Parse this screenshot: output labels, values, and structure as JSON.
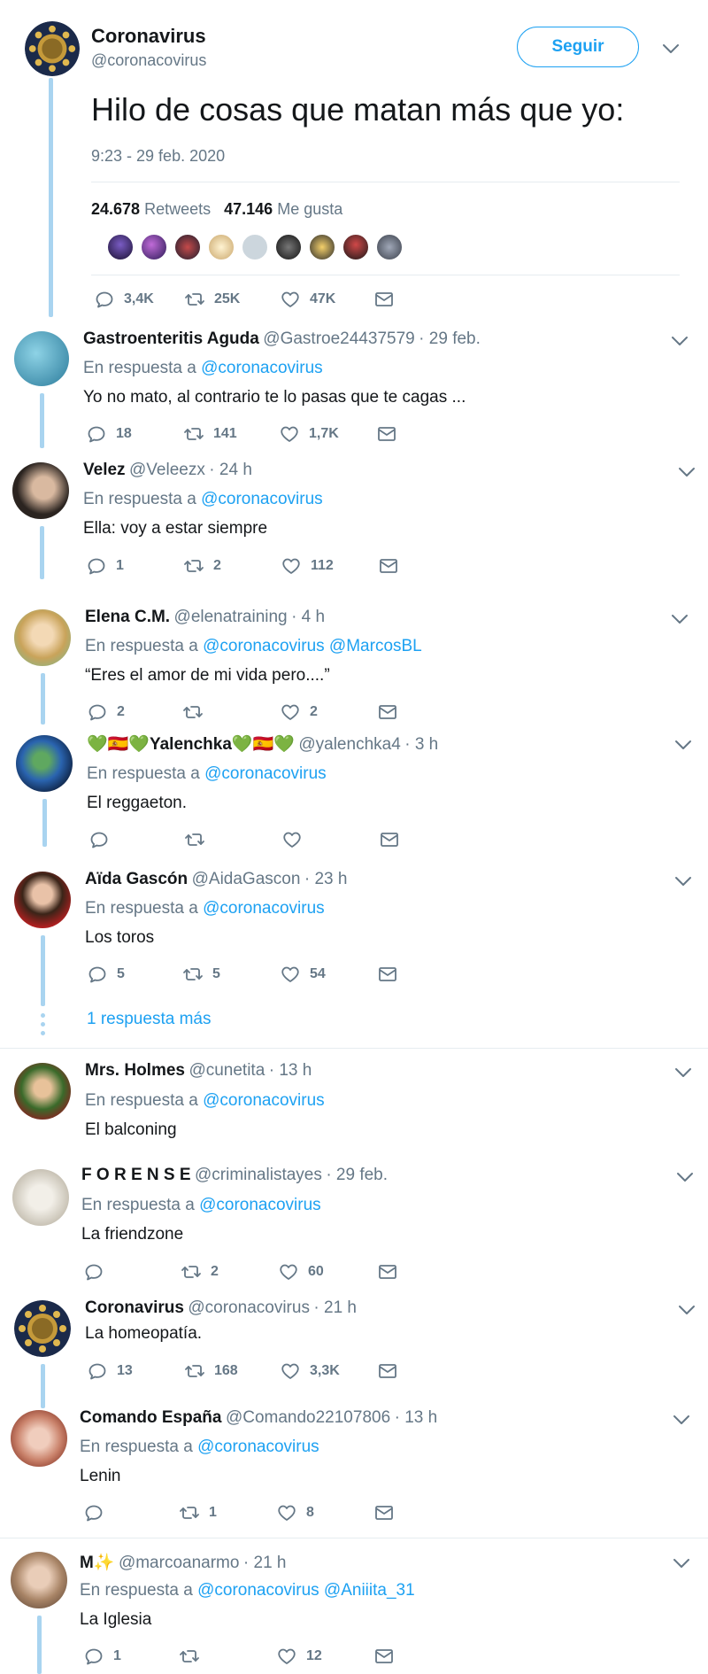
{
  "main_tweet": {
    "name": "Coronavirus",
    "handle": "@coronacovirus",
    "follow_label": "Seguir",
    "text": "Hilo de cosas que matan más que yo:",
    "timestamp": "9:23 - 29 feb. 2020",
    "retweets_count": "24.678",
    "retweets_label": "Retweets",
    "likes_count": "47.146",
    "likes_label": "Me gusta",
    "reply_count": "3,4K",
    "retweet_count": "25K",
    "like_count": "47K"
  },
  "replies": [
    {
      "name": "Gastroenteritis Aguda",
      "handle": "@Gastroe24437579",
      "time": "· 29 feb.",
      "reply_prefix": "En respuesta a",
      "reply_to": "@coronacovirus",
      "text": "Yo no mato, al contrario te lo pasas que te cagas ...",
      "replies": "18",
      "retweets": "141",
      "likes": "1,7K"
    },
    {
      "name": "Velez",
      "handle": "@Veleezx",
      "time": "· 24 h",
      "reply_prefix": "En respuesta a",
      "reply_to": "@coronacovirus",
      "text": "Ella: voy a estar siempre",
      "replies": "1",
      "retweets": "2",
      "likes": "112"
    },
    {
      "name": "Elena C.M.",
      "handle": "@elenatraining",
      "time": "· 4 h",
      "reply_prefix": "En respuesta a",
      "reply_to": "@coronacovirus @MarcosBL",
      "text": "“Eres el amor de mi vida pero....”",
      "replies": "2",
      "retweets": "",
      "likes": "2"
    },
    {
      "name": "💚🇪🇸💚Yalenchka💚🇪🇸💚",
      "handle": "@yalenchka4",
      "time": "· 3 h",
      "reply_prefix": "En respuesta a",
      "reply_to": "@coronacovirus",
      "text": "El reggaeton.",
      "replies": "",
      "retweets": "",
      "likes": ""
    },
    {
      "name": "Aïda Gascón",
      "handle": "@AidaGascon",
      "time": "· 23 h",
      "reply_prefix": "En respuesta a",
      "reply_to": "@coronacovirus",
      "text": "Los toros",
      "replies": "5",
      "retweets": "5",
      "likes": "54"
    },
    {
      "name": "Mrs. Holmes",
      "handle": "@cunetita",
      "time": "· 13 h",
      "reply_prefix": "En respuesta a",
      "reply_to": "@coronacovirus",
      "text": "El balconing"
    },
    {
      "name": "F O R E N S E",
      "handle": "@criminalistayes",
      "time": "· 29 feb.",
      "reply_prefix": "En respuesta a",
      "reply_to": "@coronacovirus",
      "text": "La friendzone",
      "replies": "",
      "retweets": "2",
      "likes": "60"
    },
    {
      "name": "Coronavirus",
      "handle": "@coronacovirus",
      "time": "· 21 h",
      "text": "La homeopatía.",
      "replies": "13",
      "retweets": "168",
      "likes": "3,3K"
    },
    {
      "name": "Comando España",
      "handle": "@Comando22107806",
      "time": "· 13 h",
      "reply_prefix": "En respuesta a",
      "reply_to": "@coronacovirus",
      "text": "Lenin",
      "replies": "",
      "retweets": "1",
      "likes": "8"
    },
    {
      "name": "M✨",
      "handle": "@marcoanarmo",
      "time": "· 21 h",
      "reply_prefix": "En respuesta a",
      "reply_to": "@coronacovirus @Aniiita_31",
      "text": "La Iglesia",
      "replies": "1",
      "retweets": "",
      "likes": "12"
    }
  ],
  "more_replies_label": "1 respuesta más",
  "colors": {
    "link": "#1da1f2",
    "muted": "#657786",
    "thread_line": "#a9d4f0"
  }
}
